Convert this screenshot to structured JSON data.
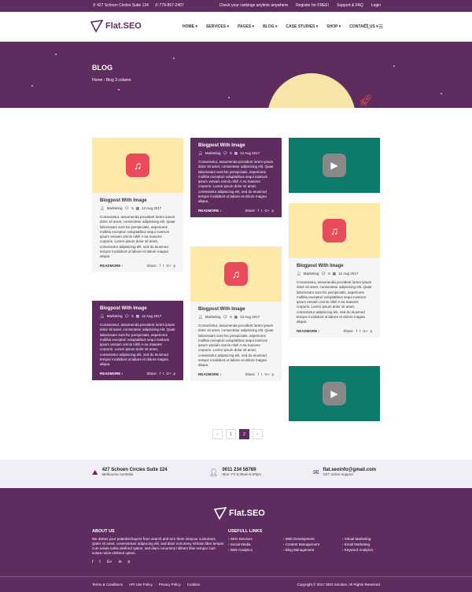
{
  "topbar": {
    "address": "427 Schoen Circles Suite 124",
    "phone": "779-867-2407",
    "links": [
      "Check your rankings anytime anywhere",
      "Register for FREE!",
      "Support & FAQ",
      "Login"
    ]
  },
  "header": {
    "logo": "Flat.SEO",
    "nav": [
      "HOME",
      "SERVICES",
      "PAGES",
      "BLOG",
      "CASE STUDIES",
      "SHOP",
      "CONTACT US"
    ]
  },
  "hero": {
    "title": "BLOG",
    "breadcrumb_home": "Home",
    "breadcrumb_sep": "›",
    "breadcrumb_current": "Blog 3 column"
  },
  "post": {
    "title": "Blogpost With Image",
    "category": "Marketing",
    "comments": "5",
    "date": "12 Aug 2017",
    "excerpt": "Consectetur, assumenda provident lorem ipsum dolor sit amet, consectetur adipisicing elit. Quae laboriosam sunt hic perspiciatis, asperiores mollitia excepturi voluptatibus sequi nostrum ipsum veniam omnis nihil! A ea maiores corporis. Lorem ipsum dolor sit amet, consectetur adipisicing elit, sed do eiusmod tempor incididunt ut labore et dolore magna aliqua.",
    "readmore": "READMORE ›",
    "share": "Share:",
    "share_icons": [
      "f",
      "t",
      "G+",
      "p"
    ]
  },
  "pagination": [
    "‹",
    "1",
    "2",
    "›"
  ],
  "contact": {
    "address_line1": "427 Schoen Circles Suite 124",
    "address_line2": "Melbourne Australia",
    "phone_line1": "0011 234 56789",
    "phone_line2": "Mon- Fri 8:30am-6:30pm",
    "email_line1": "flat.seoinfo@gmail.com",
    "email_line2": "24/7 online support"
  },
  "footer": {
    "logo": "Flat.SEO",
    "about_title": "ABOUT US",
    "about_text": "We attract your potential buyers from search and turn them intoyour customers. Quter sit amet, consectetuer adipiscing elit, sed diam nonummy nibham liber tempor cum soluta nobis eleifend option. sed diam nonummy nibham liber tempor cum soluta nobis eleifend option.",
    "social": [
      "f",
      "t",
      "G+",
      "in",
      "p"
    ],
    "links_title": "USEFULL LINKS",
    "links": [
      "SEO Services",
      "Web Development",
      "Virtual Marketing",
      "Social Media",
      "Content Management",
      "Email Marketing",
      "Web Analytics",
      "Blog Management",
      "Keyword Analytics"
    ],
    "bottom_links": [
      "Terms & Conditions",
      "API Use Policy",
      "Privacy Policy",
      "Cookies"
    ],
    "copyright": "Copyright © 2017 SEO Solution. All Rights Reserved."
  },
  "colors": {
    "brand": "#5e2c5e",
    "teal": "#0d7b6c",
    "yellow": "#fde9a8",
    "music": "#e94b5b"
  }
}
